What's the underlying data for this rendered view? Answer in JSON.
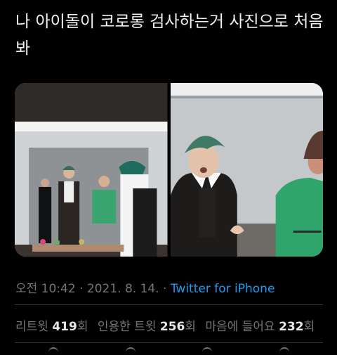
{
  "tweet": {
    "text": "나 아이돌이 코로롱 검사하는거 사진으로 처음 봐",
    "time": "오전 10:42",
    "dot1": " · ",
    "date": "2021. 8. 14.",
    "dot2": " · ",
    "source": "Twitter for iPhone"
  },
  "stats": {
    "retweets_label": "리트윗",
    "retweets_count": "419",
    "retweets_unit": "회",
    "quotes_label": "인용한 트윗",
    "quotes_count": "256",
    "quotes_unit": "회",
    "likes_label": "마음에 들어요",
    "likes_count": "232",
    "likes_unit": "회"
  },
  "colors": {
    "background": "#000000",
    "link": "#1d9bf0",
    "muted": "#71767b"
  },
  "icons": [
    "reply-icon",
    "retweet-icon",
    "like-icon",
    "share-icon"
  ]
}
